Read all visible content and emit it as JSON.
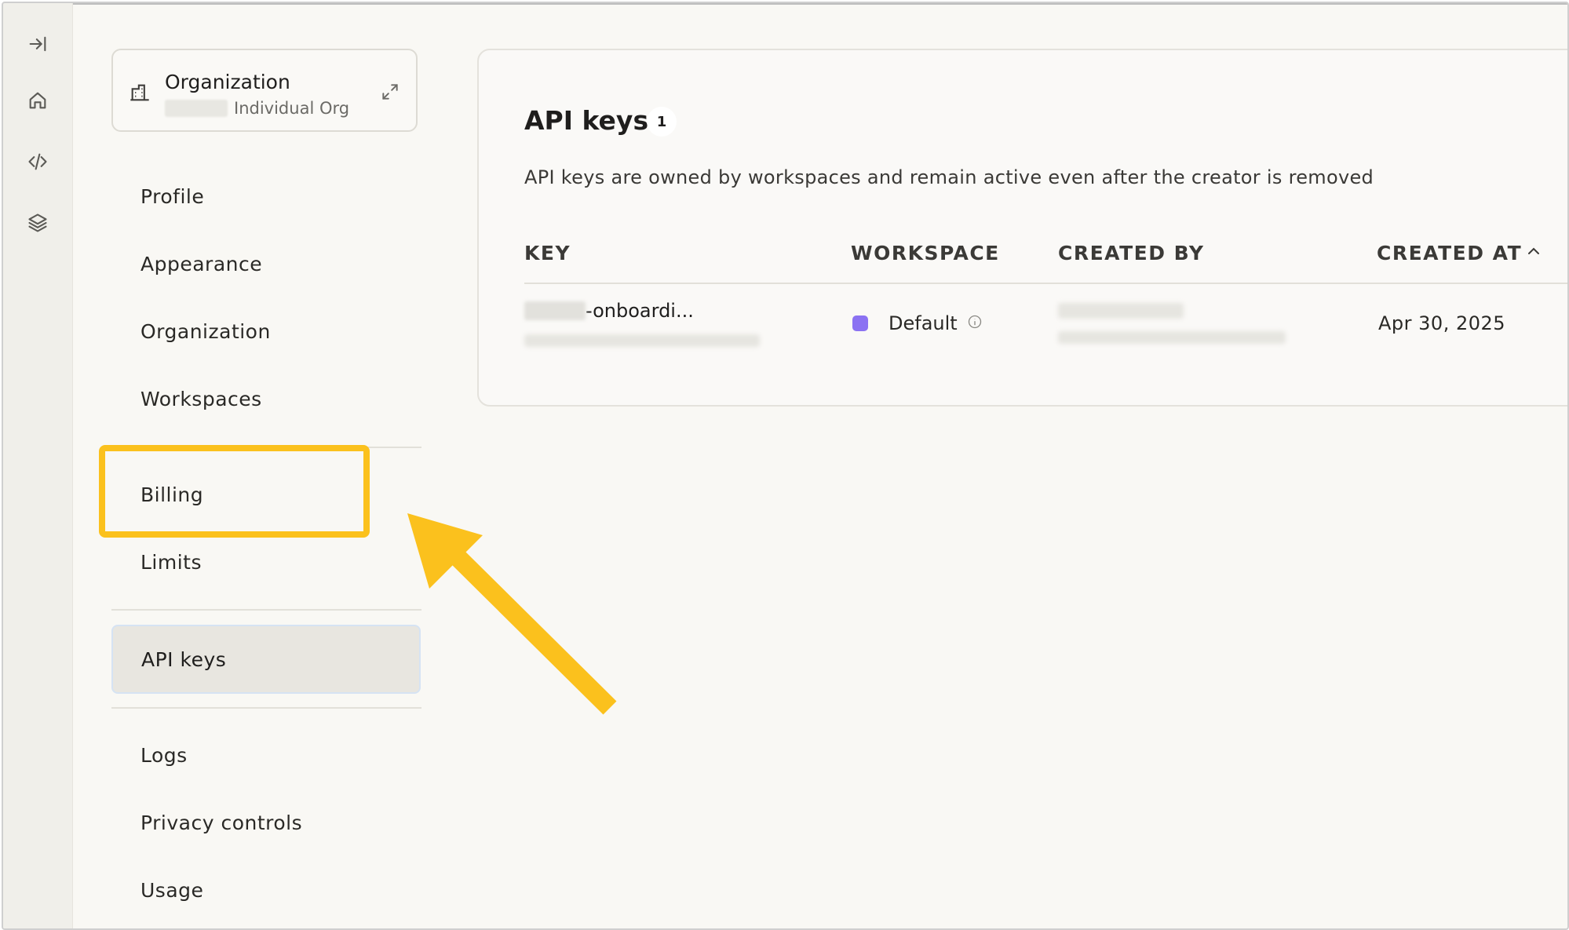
{
  "rail": {
    "icons": [
      "collapse-sidebar-icon",
      "home-icon",
      "code-icon",
      "layers-icon"
    ]
  },
  "org": {
    "title": "Organization",
    "subtitle": "Individual Org"
  },
  "nav": {
    "items": [
      "Profile",
      "Appearance",
      "Organization",
      "Workspaces",
      "Billing",
      "Limits",
      "API keys",
      "Logs",
      "Privacy controls",
      "Usage"
    ],
    "active": "API keys"
  },
  "panel": {
    "title": "API keys",
    "count": "1",
    "description": "API keys are owned by workspaces and remain active even after the creator is removed",
    "columns": [
      "KEY",
      "WORKSPACE",
      "CREATED BY",
      "CREATED AT"
    ],
    "rows": [
      {
        "key": "-onboardi...",
        "workspace": "Default",
        "created_at": "Apr 30, 2025"
      }
    ]
  },
  "colors": {
    "highlight": "#fbc11d",
    "workspace_dot": "#8b72f2"
  }
}
